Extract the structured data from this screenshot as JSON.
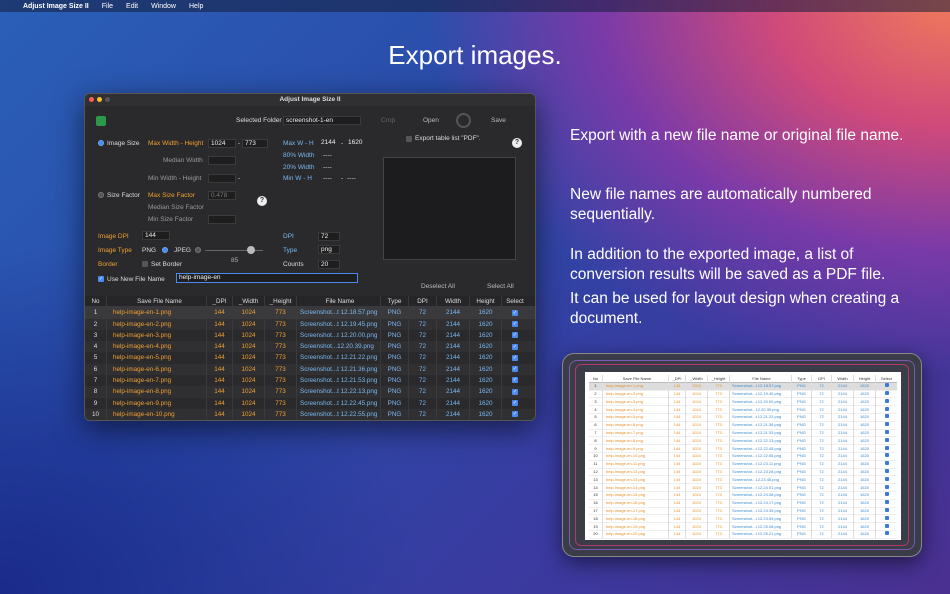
{
  "menubar": {
    "app": "Adjust Image Size II",
    "items": [
      "File",
      "Edit",
      "Window",
      "Help"
    ]
  },
  "headline": "Export images.",
  "right_text": [
    "Export with a new file name or original file name.",
    "New file names are automatically numbered sequentially.",
    "In addition to the exported image, a list of conversion results will be saved as a PDF file.",
    "It can be used for layout design when creating a document."
  ],
  "window": {
    "title": "Adjust Image Size II",
    "selected_folder_label": "Selected Folder",
    "selected_folder_value": "screenshot-1-en",
    "crop_label": "Crop",
    "open_label": "Open",
    "save_label": "Save",
    "export_pdf_label": "Export table list \"PDF\".",
    "image_size_label": "Image Size",
    "max_wh_label": "Max Width - Height",
    "max_w": "1024",
    "max_h": "773",
    "median_width_label": "Median Width",
    "min_wh_label": "Min Width - Height",
    "maxWH_label": "Max W - H",
    "maxWH_w": "2144",
    "maxWH_h": "1620",
    "pct80_label": "80% Width",
    "pct80_val": "----",
    "pct20_label": "20% Width",
    "pct20_val": "----",
    "minWH_label": "Min W - H",
    "minWH_w": "----",
    "minWH_h": "----",
    "dash": "-",
    "size_factor_label": "Size Factor",
    "max_size_factor_label": "Max Size Factor",
    "max_size_factor_value": "0.478",
    "median_size_factor_label": "Median Size Factor",
    "min_size_factor_label": "Min Size Factor",
    "image_dpi_label": "Image DPI",
    "image_dpi_value": "144",
    "image_type_label": "Image Type",
    "png_label": "PNG",
    "jpeg_label": "JPEG",
    "jpeg_quality": "85",
    "border_label": "Border",
    "set_border_label": "Set Border",
    "use_new_name_label": "Use New File Name",
    "new_name_value": "help-image-en",
    "info_dpi_label": "DPI",
    "info_dpi_value": "72",
    "info_type_label": "Type",
    "info_type_value": "png",
    "info_counts_label": "Counts",
    "info_counts_value": "20",
    "deselect_all": "Deselect All",
    "select_all": "Select All",
    "help": "?"
  },
  "table": {
    "headers": [
      "No",
      "Save File Name",
      "_DPI",
      "_Width",
      "_Height",
      "File Name",
      "Type",
      "DPI",
      "Width",
      "Height",
      "Select"
    ],
    "rows": [
      [
        "1",
        "help-image-en-1.png",
        "144",
        "1024",
        "773",
        "Screenshot...t 12.18.57.png",
        "PNG",
        "72",
        "2144",
        "1620"
      ],
      [
        "2",
        "help-image-en-2.png",
        "144",
        "1024",
        "773",
        "Screenshot...t 12.19.45.png",
        "PNG",
        "72",
        "2144",
        "1620"
      ],
      [
        "3",
        "help-image-en-3.png",
        "144",
        "1024",
        "773",
        "Screenshot...t 12.20.00.png",
        "PNG",
        "72",
        "2144",
        "1620"
      ],
      [
        "4",
        "help-image-en-4.png",
        "144",
        "1024",
        "773",
        "Screenshot...12.20.39.png",
        "PNG",
        "72",
        "2144",
        "1620"
      ],
      [
        "5",
        "help-image-en-5.png",
        "144",
        "1024",
        "773",
        "Screenshot...t 12.21.22.png",
        "PNG",
        "72",
        "2144",
        "1620"
      ],
      [
        "6",
        "help-image-en-6.png",
        "144",
        "1024",
        "773",
        "Screenshot...t 12.21.36.png",
        "PNG",
        "72",
        "2144",
        "1620"
      ],
      [
        "7",
        "help-image-en-7.png",
        "144",
        "1024",
        "773",
        "Screenshot...t 12.21.53.png",
        "PNG",
        "72",
        "2144",
        "1620"
      ],
      [
        "8",
        "help-image-en-8.png",
        "144",
        "1024",
        "773",
        "Screenshot...t 12.22.13.png",
        "PNG",
        "72",
        "2144",
        "1620"
      ],
      [
        "9",
        "help-image-en-9.png",
        "144",
        "1024",
        "773",
        "Screenshot...t 12.22.45.png",
        "PNG",
        "72",
        "2144",
        "1620"
      ],
      [
        "10",
        "help-image-en-10.png",
        "144",
        "1024",
        "773",
        "Screenshot...t 12.22.55.png",
        "PNG",
        "72",
        "2144",
        "1620"
      ]
    ]
  },
  "pdf_table": {
    "headers": [
      "No",
      "Save File Name",
      "_DPI",
      "_Width",
      "_Height",
      "File Name",
      "Type",
      "DPI",
      "Width",
      "Height",
      "Select"
    ],
    "rows": [
      [
        "1",
        "help-image-en-1.png",
        "144",
        "1024",
        "773",
        "Screenshot...t 12.18.57.png",
        "PNG",
        "72",
        "2144",
        "1620"
      ],
      [
        "2",
        "help-image-en-2.png",
        "144",
        "1024",
        "773",
        "Screenshot...t 12.19.45.png",
        "PNG",
        "72",
        "2144",
        "1620"
      ],
      [
        "3",
        "help-image-en-3.png",
        "144",
        "1024",
        "773",
        "Screenshot...t 12.20.00.png",
        "PNG",
        "72",
        "2144",
        "1620"
      ],
      [
        "4",
        "help-image-en-4.png",
        "144",
        "1024",
        "773",
        "Screenshot...12.20.39.png",
        "PNG",
        "72",
        "2144",
        "1620"
      ],
      [
        "5",
        "help-image-en-5.png",
        "144",
        "1024",
        "773",
        "Screenshot...t 12.21.22.png",
        "PNG",
        "72",
        "2144",
        "1620"
      ],
      [
        "6",
        "help-image-en-6.png",
        "144",
        "1024",
        "773",
        "Screenshot...t 12.21.36.png",
        "PNG",
        "72",
        "2144",
        "1620"
      ],
      [
        "7",
        "help-image-en-7.png",
        "144",
        "1024",
        "773",
        "Screenshot...t 12.21.53.png",
        "PNG",
        "72",
        "2144",
        "1620"
      ],
      [
        "8",
        "help-image-en-8.png",
        "144",
        "1024",
        "773",
        "Screenshot...t 12.22.13.png",
        "PNG",
        "72",
        "2144",
        "1620"
      ],
      [
        "9",
        "help-image-en-9.png",
        "144",
        "1024",
        "773",
        "Screenshot...t 12.22.45.png",
        "PNG",
        "72",
        "2144",
        "1620"
      ],
      [
        "10",
        "help-image-en-10.png",
        "144",
        "1024",
        "773",
        "Screenshot...t 12.22.55.png",
        "PNG",
        "72",
        "2144",
        "1620"
      ],
      [
        "11",
        "help-image-en-11.png",
        "144",
        "1024",
        "773",
        "Screenshot...t 12.23.11.png",
        "PNG",
        "72",
        "2144",
        "1620"
      ],
      [
        "12",
        "help-image-en-12.png",
        "144",
        "1024",
        "773",
        "Screenshot...t 12.23.28.png",
        "PNG",
        "72",
        "2144",
        "1620"
      ],
      [
        "13",
        "help-image-en-13.png",
        "144",
        "1024",
        "773",
        "Screenshot...12.23.45.png",
        "PNG",
        "72",
        "2144",
        "1620"
      ],
      [
        "14",
        "help-image-en-14.png",
        "144",
        "1024",
        "773",
        "Screenshot...t 12.24.01.png",
        "PNG",
        "72",
        "2144",
        "1620"
      ],
      [
        "15",
        "help-image-en-15.png",
        "144",
        "1024",
        "773",
        "Screenshot...t 12.24.08.png",
        "PNG",
        "72",
        "2144",
        "1620"
      ],
      [
        "16",
        "help-image-en-16.png",
        "144",
        "1024",
        "773",
        "Screenshot...t 12.24.17.png",
        "PNG",
        "72",
        "2144",
        "1620"
      ],
      [
        "17",
        "help-image-en-17.png",
        "144",
        "1024",
        "773",
        "Screenshot...t 12.24.35.png",
        "PNG",
        "72",
        "2144",
        "1620"
      ],
      [
        "18",
        "help-image-en-18.png",
        "144",
        "1024",
        "773",
        "Screenshot...t 12.24.59.png",
        "PNG",
        "72",
        "2144",
        "1620"
      ],
      [
        "19",
        "help-image-en-19.png",
        "144",
        "1024",
        "773",
        "Screenshot...t 12.25.08.png",
        "PNG",
        "72",
        "2144",
        "1620"
      ],
      [
        "20",
        "help-image-en-20.png",
        "144",
        "1024",
        "773",
        "Screenshot...t 12.25.21.png",
        "PNG",
        "72",
        "2144",
        "1620"
      ]
    ]
  },
  "colors": {
    "accent": "#4a8af0",
    "orange": "#f0a030",
    "blue_text": "#7ab8f0"
  }
}
